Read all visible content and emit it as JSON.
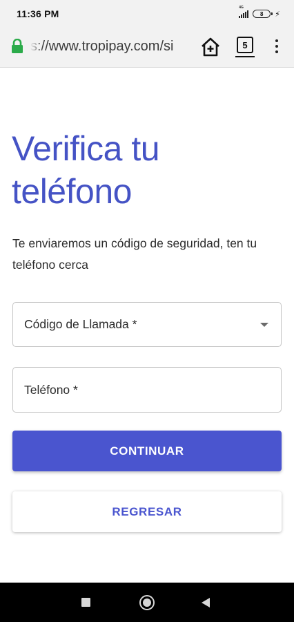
{
  "status_bar": {
    "time": "11:36 PM",
    "network_label": "4G",
    "battery_level": "8"
  },
  "browser": {
    "url": "s://www.tropipay.com/si",
    "tab_count": "5",
    "icons": {
      "lock": "lock-icon",
      "home": "home-plus-icon",
      "tabs": "tab-switcher-icon",
      "menu": "overflow-menu-icon"
    }
  },
  "page": {
    "title_line1": "Verifica tu",
    "title_line2": "teléfono",
    "subtitle": "Te enviaremos un código de seguridad, ten tu teléfono cerca",
    "calling_code_label": "Código de Llamada *",
    "phone_label": "Teléfono *",
    "continue_label": "CONTINUAR",
    "back_label": "REGRESAR"
  },
  "colors": {
    "accent": "#4a55cf",
    "title": "#4553c5",
    "lock": "#2bab4a"
  }
}
